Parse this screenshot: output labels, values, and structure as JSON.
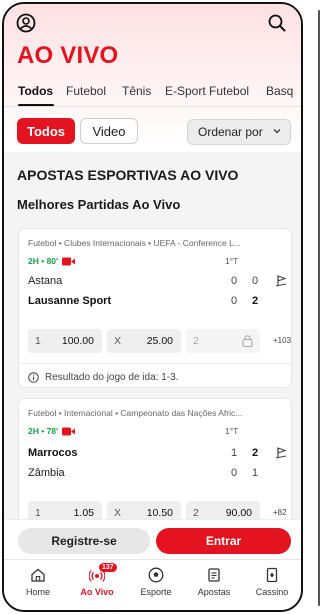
{
  "header": {
    "title": "AO VIVO"
  },
  "tabs": [
    "Todos",
    "Futebol",
    "Tênis",
    "E-Sport Futebol",
    "Basq"
  ],
  "filters": {
    "all": "Todos",
    "video": "Video",
    "sort": "Ordenar por"
  },
  "section": {
    "title": "APOSTAS ESPORTIVAS AO VIVO",
    "subtitle": "Melhores Partidas Ao Vivo"
  },
  "matches": [
    {
      "league": "Futebol • Clubes Internacionais • UEFA - Conference L...",
      "live": "2H • 80'",
      "period": "1°T",
      "home": {
        "name": "Astana",
        "p1": "0",
        "p2": "0"
      },
      "away": {
        "name": "Lausanne Sport",
        "p1": "0",
        "p2": "2"
      },
      "odds": [
        {
          "label": "1",
          "value": "100.00"
        },
        {
          "label": "X",
          "value": "25.00"
        },
        {
          "label": "2",
          "value": ""
        }
      ],
      "more": "+103",
      "note": "Resultado do jogo de ida: 1-3."
    },
    {
      "league": "Futebol • Internacional • Campeonato das Nações Afric...",
      "live": "2H • 78'",
      "period": "1°T",
      "home": {
        "name": "Marrocos",
        "p1": "1",
        "p2": "2"
      },
      "away": {
        "name": "Zâmbia",
        "p1": "0",
        "p2": "1"
      },
      "odds": [
        {
          "label": "1",
          "value": "1.05"
        },
        {
          "label": "X",
          "value": "10.50"
        },
        {
          "label": "2",
          "value": "90.00"
        }
      ],
      "more": "+82"
    }
  ],
  "actions": {
    "register": "Registre-se",
    "login": "Entrar"
  },
  "nav": [
    {
      "label": "Home",
      "icon": "home-icon"
    },
    {
      "label": "Ao Vivo",
      "icon": "live-icon",
      "badge": "137"
    },
    {
      "label": "Esporte",
      "icon": "soccer-ball-icon"
    },
    {
      "label": "Apostas",
      "icon": "betslip-icon"
    },
    {
      "label": "Cassino",
      "icon": "casino-icon"
    }
  ],
  "colors": {
    "accent": "#e3141f",
    "live": "#16a34a"
  }
}
